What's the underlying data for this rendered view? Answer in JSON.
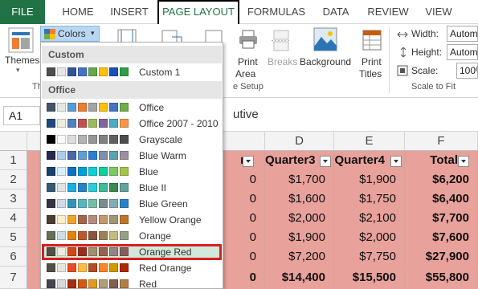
{
  "tabs": [
    "FILE",
    "HOME",
    "INSERT",
    "PAGE LAYOUT",
    "FORMULAS",
    "DATA",
    "REVIEW",
    "VIEW"
  ],
  "active_tab": "PAGE LAYOUT",
  "ribbon": {
    "themes_label": "Themes",
    "themes_group_label": "Th",
    "colors_label": "Colors",
    "print_area_line1": "Print",
    "print_area_line2": "Area",
    "breaks_label": "Breaks",
    "background_label": "Background",
    "print_titles_line1": "Print",
    "print_titles_line2": "Titles",
    "page_setup_label": "e Setup",
    "width_label": "Width:",
    "width_value": "Autom",
    "height_label": "Height:",
    "height_value": "Autom",
    "scale_label": "Scale:",
    "scale_value": "100%",
    "scale_group_label": "Scale to Fit"
  },
  "formula_bar": {
    "name_box": "A1",
    "content": "utive"
  },
  "grid": {
    "col_headers": [
      "D",
      "E",
      "F"
    ],
    "row_headers": [
      "1",
      "2",
      "3",
      "4",
      "5",
      "6",
      "7"
    ],
    "header_row": {
      "c": "r",
      "d": "Quarter3",
      "e": "Quarter4",
      "f": "Total"
    },
    "rows": [
      {
        "c": "0",
        "d": "$1,700",
        "e": "$1,900",
        "f": "$6,200"
      },
      {
        "c": "0",
        "d": "$1,600",
        "e": "$1,750",
        "f": "$6,400"
      },
      {
        "c": "0",
        "d": "$2,000",
        "e": "$2,100",
        "f": "$7,700"
      },
      {
        "c": "0",
        "d": "$1,900",
        "e": "$2,000",
        "f": "$7,600"
      },
      {
        "c": "0",
        "d": "$7,200",
        "e": "$7,750",
        "f": "$27,900"
      },
      {
        "c": "0",
        "d": "$14,400",
        "e": "$15,500",
        "f": "$55,800"
      }
    ]
  },
  "dropdown": {
    "custom_section": "Custom",
    "office_section": "Office",
    "items": [
      {
        "label": "Custom 1",
        "colors": [
          "#4d4d4d",
          "#e6e6e6",
          "#2e5597",
          "#4472c4",
          "#6aa84f",
          "#ffc000",
          "#1a4fb4",
          "#2f9e45"
        ]
      },
      {
        "label": "Office",
        "colors": [
          "#44546a",
          "#e7e6e6",
          "#5b9bd5",
          "#ed7d31",
          "#a5a5a5",
          "#ffc000",
          "#4472c4",
          "#70ad47"
        ]
      },
      {
        "label": "Office 2007 - 2010",
        "colors": [
          "#1f497d",
          "#eeece1",
          "#4f81bd",
          "#c0504d",
          "#9bbb59",
          "#8064a2",
          "#4bacc6",
          "#f79646"
        ]
      },
      {
        "label": "Grayscale",
        "colors": [
          "#000000",
          "#f8f8f8",
          "#dddddd",
          "#b2b2b2",
          "#969696",
          "#808080",
          "#5f5f5f",
          "#4d4d4d"
        ]
      },
      {
        "label": "Blue Warm",
        "colors": [
          "#242852",
          "#acccea",
          "#4a66ac",
          "#629dd1",
          "#297fd5",
          "#7f8fa9",
          "#5aa2ae",
          "#9d90a0"
        ]
      },
      {
        "label": "Blue",
        "colors": [
          "#17406d",
          "#dbeff9",
          "#0f6fc6",
          "#009dd9",
          "#0bd0d9",
          "#10cf9b",
          "#7cca62",
          "#a5c249"
        ]
      },
      {
        "label": "Blue II",
        "colors": [
          "#335b74",
          "#dfe3e5",
          "#1cade4",
          "#2683c6",
          "#27ced7",
          "#42ba97",
          "#3e8853",
          "#62a39f"
        ]
      },
      {
        "label": "Blue Green",
        "colors": [
          "#373545",
          "#cedbe6",
          "#3494ba",
          "#58b6c0",
          "#75bda7",
          "#7a8c8e",
          "#84acb6",
          "#2683c6"
        ]
      },
      {
        "label": "Yellow Orange",
        "colors": [
          "#4e3b30",
          "#fbeec9",
          "#f0a22e",
          "#a5644e",
          "#b58b80",
          "#c3986d",
          "#a19574",
          "#c17529"
        ]
      },
      {
        "label": "Orange",
        "colors": [
          "#637052",
          "#ccddea",
          "#e48312",
          "#bd582c",
          "#865640",
          "#9b8357",
          "#c2bc80",
          "#94a088"
        ]
      },
      {
        "label": "Orange Red",
        "colors": [
          "#505046",
          "#eeece1",
          "#d34817",
          "#9b2d1f",
          "#a28e6a",
          "#956251",
          "#918485",
          "#855d5d"
        ]
      },
      {
        "label": "Red Orange",
        "colors": [
          "#505046",
          "#e9e5dc",
          "#e84c22",
          "#ffbd47",
          "#b64926",
          "#ff8427",
          "#cc9900",
          "#b22600"
        ]
      },
      {
        "label": "Red",
        "colors": [
          "#454551",
          "#d8d9dc",
          "#a5300f",
          "#d55816",
          "#e19825",
          "#b19c7d",
          "#7f5f52",
          "#b27d49"
        ]
      }
    ],
    "selected": "Orange Red"
  }
}
